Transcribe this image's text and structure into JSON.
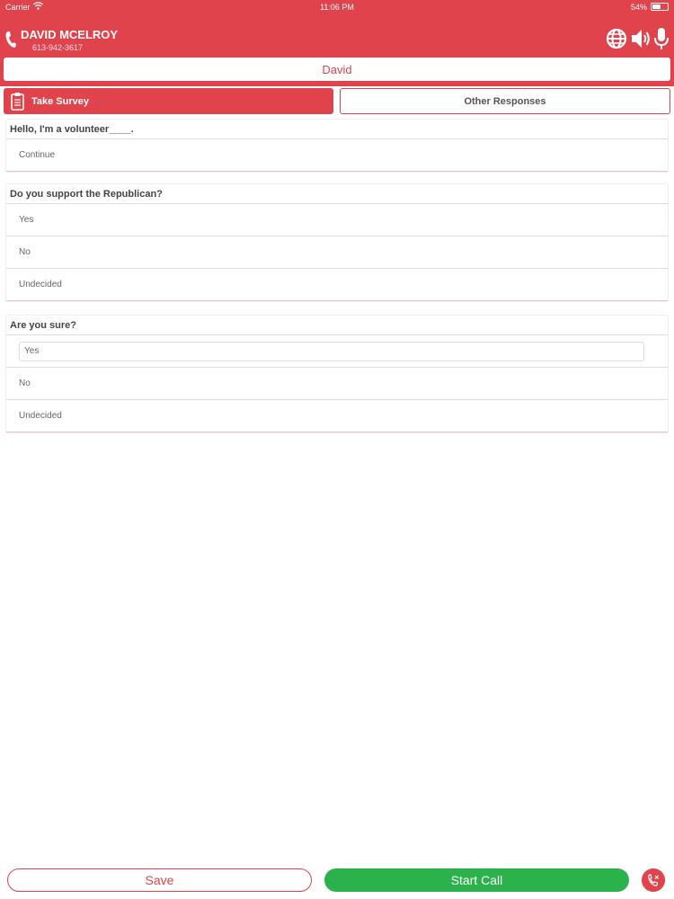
{
  "status_bar": {
    "carrier": "Carrier",
    "time": "11:06 PM",
    "battery": "54%",
    "battery_level": 0.54
  },
  "contact": {
    "name": "DAVID MCELROY",
    "phone": "613-942-3617"
  },
  "header_icons": [
    "globe-icon",
    "speaker-icon",
    "microphone-icon"
  ],
  "banner": {
    "name": "David"
  },
  "tabs": [
    {
      "label": "Take Survey",
      "active": true
    },
    {
      "label": "Other Responses",
      "active": false
    }
  ],
  "questions": [
    {
      "title": "Hello, I'm a volunteer____.",
      "options": [
        "Continue"
      ]
    },
    {
      "title": "Do you support the Republican?",
      "options": [
        "Yes",
        "No",
        "Undecided"
      ]
    },
    {
      "title": "Are you sure?",
      "options": [
        "Yes",
        "No",
        "Undecided"
      ],
      "selected": 0
    }
  ],
  "buttons": {
    "save": "Save",
    "start_call": "Start Call"
  },
  "colors": {
    "brand_red": "#e0434b",
    "call_green": "#2cb24c"
  }
}
